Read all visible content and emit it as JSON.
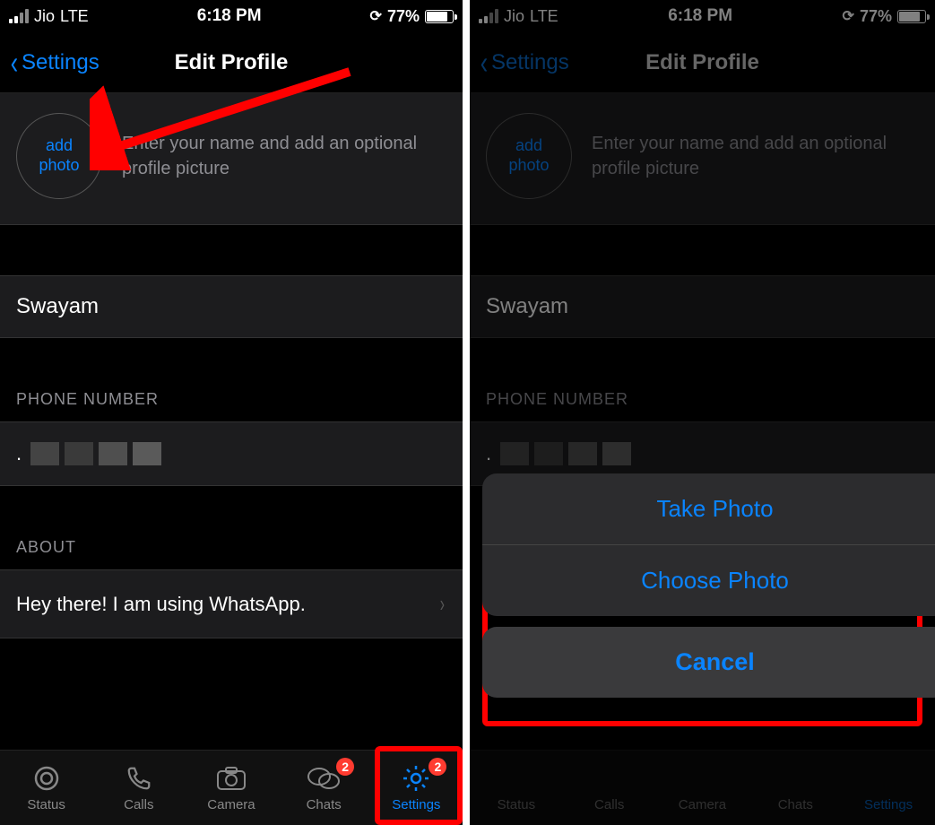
{
  "status": {
    "carrier": "Jio",
    "network": "LTE",
    "time": "6:18 PM",
    "battery_pct": "77%",
    "battery_fill_pct": 77
  },
  "nav": {
    "back_label": "Settings",
    "title": "Edit Profile"
  },
  "profile": {
    "add_photo_label": "add\nphoto",
    "hint": "Enter your name and add an optional profile picture",
    "name": "Swayam",
    "phone_header": "PHONE NUMBER",
    "about_header": "ABOUT",
    "about_value": "Hey there! I am using WhatsApp."
  },
  "tabs": {
    "status": "Status",
    "calls": "Calls",
    "camera": "Camera",
    "chats": "Chats",
    "settings": "Settings",
    "chats_badge": "2",
    "settings_badge": "2"
  },
  "sheet": {
    "take_photo": "Take Photo",
    "choose_photo": "Choose Photo",
    "cancel": "Cancel"
  }
}
